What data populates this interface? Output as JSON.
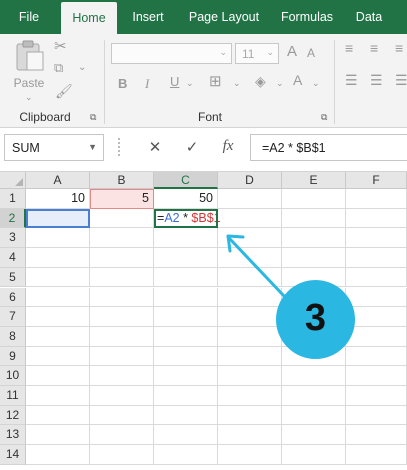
{
  "ribbon_tabs": [
    "File",
    "Home",
    "Insert",
    "Page Layout",
    "Formulas",
    "Data"
  ],
  "active_tab": "Home",
  "clipboard": {
    "paste_label": "Paste",
    "group_label": "Clipboard"
  },
  "font": {
    "font_size": "11",
    "group_label": "Font",
    "bold_label": "B",
    "italic_label": "I",
    "grow_label": "A",
    "shrink_label": "A"
  },
  "formula_bar": {
    "name_box": "SUM",
    "cancel_glyph": "✕",
    "enter_glyph": "✓",
    "fx_label": "fx",
    "formula": "=A2 * $B$1"
  },
  "columns": [
    "A",
    "B",
    "C",
    "D",
    "E",
    "F"
  ],
  "rows": [
    "1",
    "2",
    "3",
    "4",
    "5",
    "6",
    "7",
    "8",
    "9",
    "10",
    "11",
    "12",
    "13",
    "14"
  ],
  "cells": {
    "A1": "10",
    "B1": "5",
    "C1": "50"
  },
  "active_cell": "C2",
  "editing_tokens": [
    {
      "text": "=",
      "kind": "op"
    },
    {
      "text": "A2",
      "kind": "ref-a"
    },
    {
      "text": " * ",
      "kind": "op"
    },
    {
      "text": "$B$1",
      "kind": "ref-b"
    }
  ],
  "callout": {
    "number": "3",
    "color": "#2ab7e2"
  },
  "colors": {
    "ribbon_green": "#217346",
    "ref_a_blue": "#3a6fd6",
    "ref_b_red": "#d23838"
  }
}
